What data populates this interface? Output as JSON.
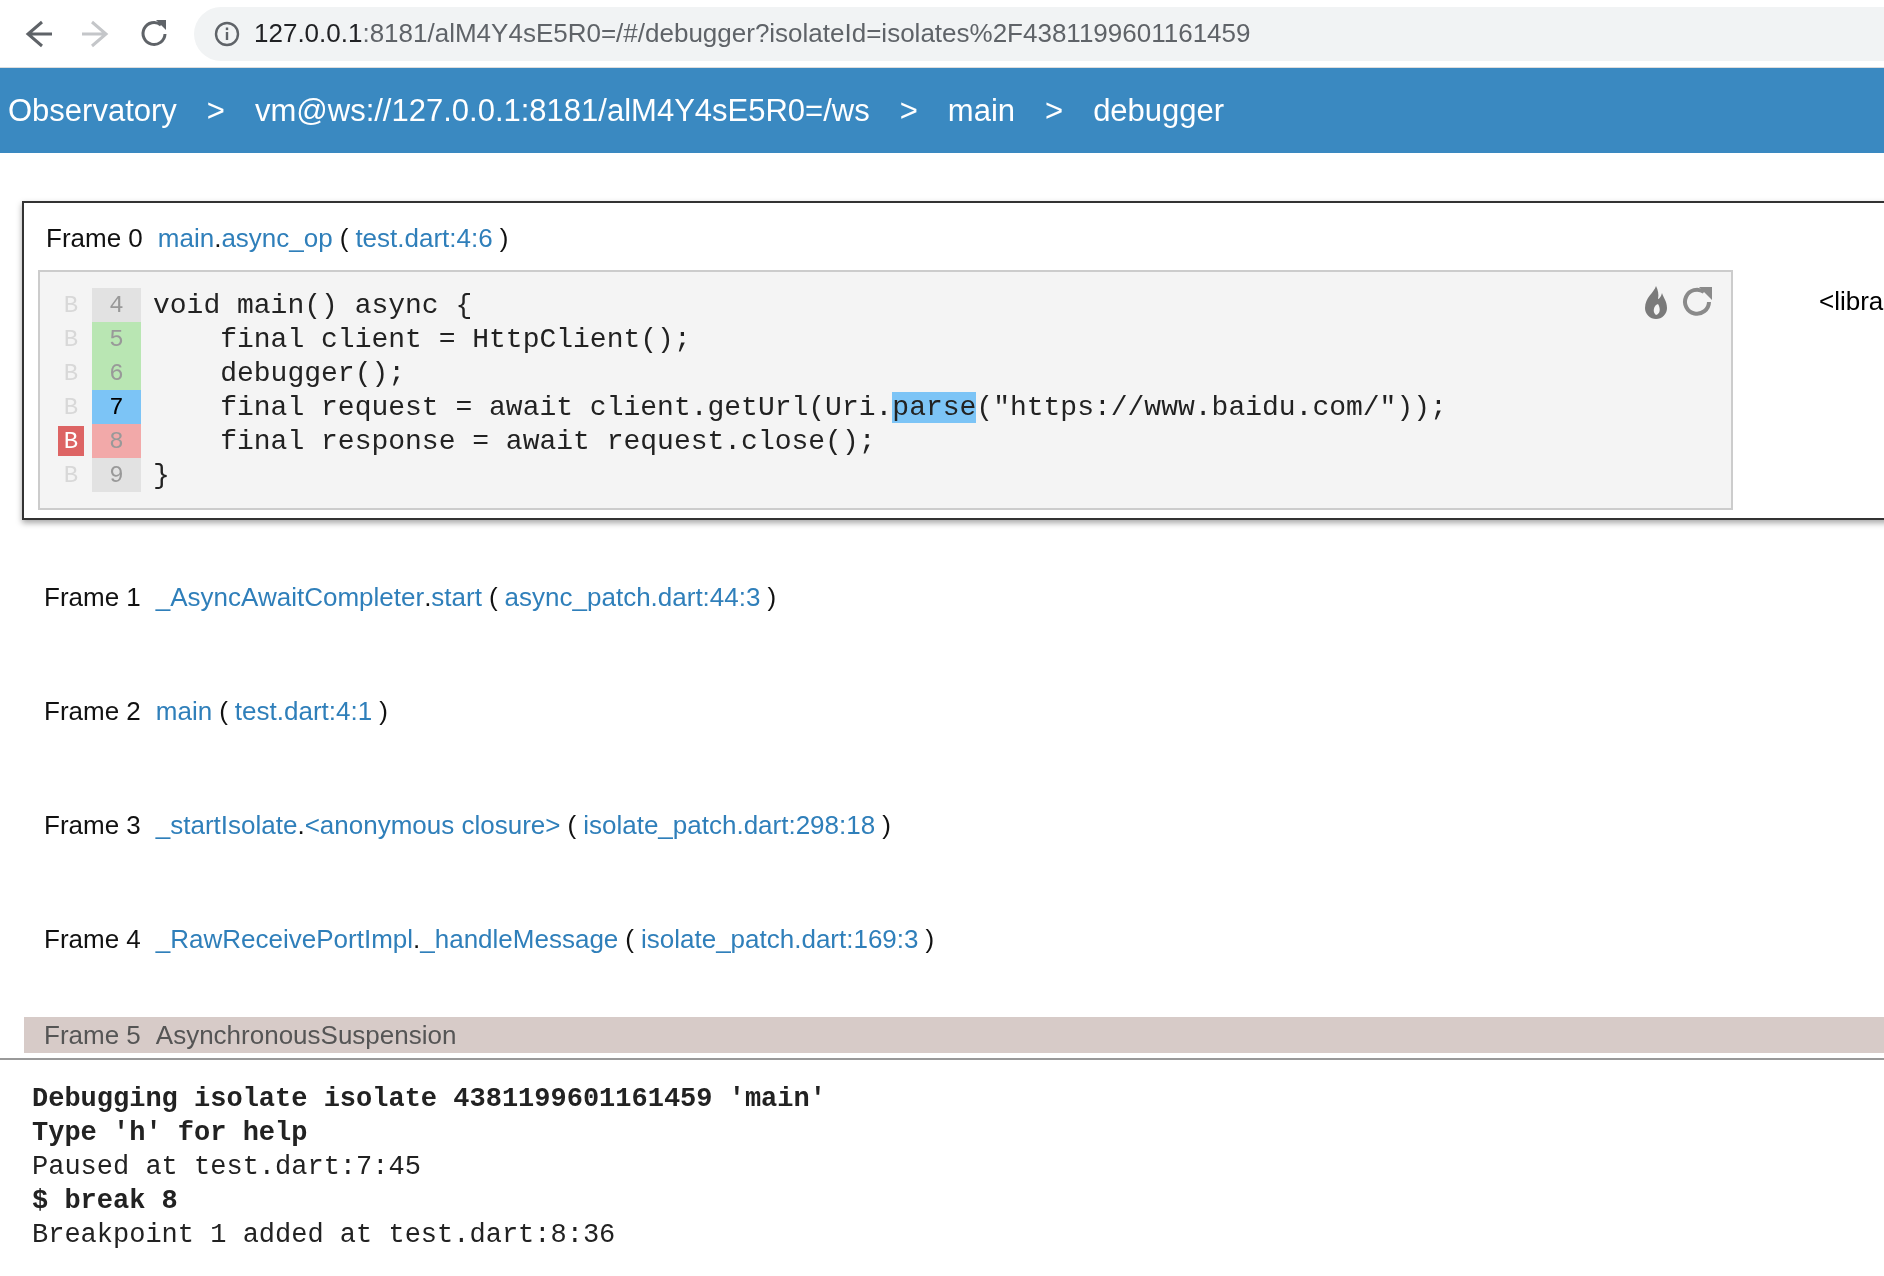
{
  "browser": {
    "address_host": "127.0.0.1",
    "address_path": ":8181/alM4Y4sE5R0=/#/debugger?isolateId=isolates%2F4381199601161459",
    "back_enabled": true,
    "forward_enabled": false
  },
  "breadcrumbs": [
    {
      "label": "Observatory",
      "separator": ">"
    },
    {
      "label": "vm@ws://127.0.0.1:8181/alM4Y4sE5R0=/ws",
      "separator": ">"
    },
    {
      "label": "main",
      "separator": ">"
    },
    {
      "label": "debugger"
    }
  ],
  "frames": [
    {
      "label": "Frame 0",
      "function": [
        {
          "text": "main",
          "kind": "link"
        },
        {
          "text": ".",
          "kind": "plain"
        },
        {
          "text": "async_op",
          "kind": "link"
        }
      ],
      "paren_open": "(",
      "location": "test.dart:4:6",
      "paren_close": ")",
      "expanded": true,
      "side_text": "<libra",
      "code": [
        {
          "mark": "B",
          "breakpoint": false,
          "number": "4",
          "kind": "idle",
          "parts": [
            {
              "text": "void main() async {",
              "selected": false
            }
          ]
        },
        {
          "mark": "B",
          "breakpoint": false,
          "number": "5",
          "kind": "executed",
          "parts": [
            {
              "text": "    final client = HttpClient();",
              "selected": false
            }
          ]
        },
        {
          "mark": "B",
          "breakpoint": false,
          "number": "6",
          "kind": "executed",
          "parts": [
            {
              "text": "    debugger();",
              "selected": false
            }
          ]
        },
        {
          "mark": "B",
          "breakpoint": false,
          "number": "7",
          "kind": "current",
          "parts": [
            {
              "text": "    final request = await client.getUrl(Uri.",
              "selected": false
            },
            {
              "text": "parse",
              "selected": true
            },
            {
              "text": "(\"https://www.baidu.com/\"));",
              "selected": false
            }
          ]
        },
        {
          "mark": "B",
          "breakpoint": true,
          "number": "8",
          "kind": "breakpoint",
          "parts": [
            {
              "text": "    final response = await request.close();",
              "selected": false
            }
          ]
        },
        {
          "mark": "B",
          "breakpoint": false,
          "number": "9",
          "kind": "idle",
          "parts": [
            {
              "text": "}",
              "selected": false
            }
          ]
        }
      ]
    },
    {
      "label": "Frame 1",
      "function": [
        {
          "text": "_AsyncAwaitCompleter",
          "kind": "link"
        },
        {
          "text": ".",
          "kind": "plain"
        },
        {
          "text": "start",
          "kind": "link"
        }
      ],
      "paren_open": "(",
      "location": "async_patch.dart:44:3",
      "paren_close": ")",
      "expanded": false
    },
    {
      "label": "Frame 2",
      "function": [
        {
          "text": "main",
          "kind": "link"
        }
      ],
      "paren_open": "(",
      "location": "test.dart:4:1",
      "paren_close": ")",
      "expanded": false
    },
    {
      "label": "Frame 3",
      "function": [
        {
          "text": "_startIsolate",
          "kind": "link"
        },
        {
          "text": ".",
          "kind": "plain"
        },
        {
          "text": "<anonymous closure>",
          "kind": "link"
        }
      ],
      "paren_open": "(",
      "location": "isolate_patch.dart:298:18",
      "paren_close": ")",
      "expanded": false
    },
    {
      "label": "Frame 4",
      "function": [
        {
          "text": "_RawReceivePortImpl",
          "kind": "link"
        },
        {
          "text": ".",
          "kind": "plain"
        },
        {
          "text": "_handleMessage",
          "kind": "link"
        }
      ],
      "paren_open": "(",
      "location": "isolate_patch.dart:169:3",
      "paren_close": ")",
      "expanded": false
    }
  ],
  "async_marker": {
    "label": "Frame 5",
    "text": "AsynchronousSuspension"
  },
  "console": [
    {
      "text": "Debugging isolate isolate 4381199601161459 'main'",
      "bold": true
    },
    {
      "text": "Type 'h' for help",
      "bold": true
    },
    {
      "text": "Paused at test.dart:7:45",
      "bold": false
    },
    {
      "text": "$ break 8",
      "bold": true
    },
    {
      "text": "Breakpoint 1 added at test.dart:8:36",
      "bold": false
    }
  ]
}
